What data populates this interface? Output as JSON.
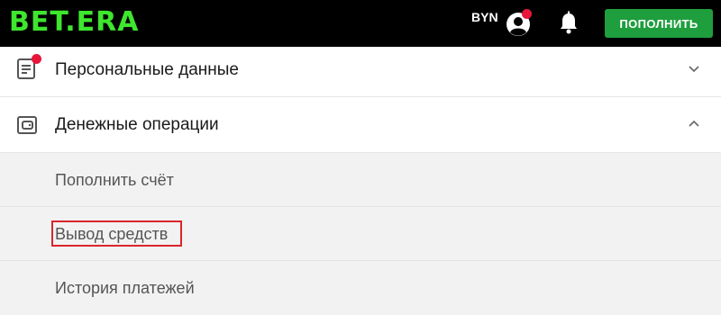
{
  "header": {
    "logo": "BET.ERA",
    "currency": "BYN",
    "topup_label": "ПОПОЛНИТЬ"
  },
  "menu": {
    "personal": {
      "label": "Персональные данные"
    },
    "money": {
      "label": "Денежные операции",
      "items": [
        {
          "label": "Пополнить счёт"
        },
        {
          "label": "Вывод средств"
        },
        {
          "label": "История платежей"
        }
      ]
    }
  },
  "colors": {
    "brand_green": "#3ee62e",
    "button_green": "#1f9e3e",
    "notification_red": "#e8173a",
    "highlight_red": "#d9262c"
  },
  "icons": [
    "user-avatar-icon",
    "bell-icon",
    "document-icon",
    "wallet-icon",
    "chevron-down-icon",
    "chevron-up-icon"
  ]
}
